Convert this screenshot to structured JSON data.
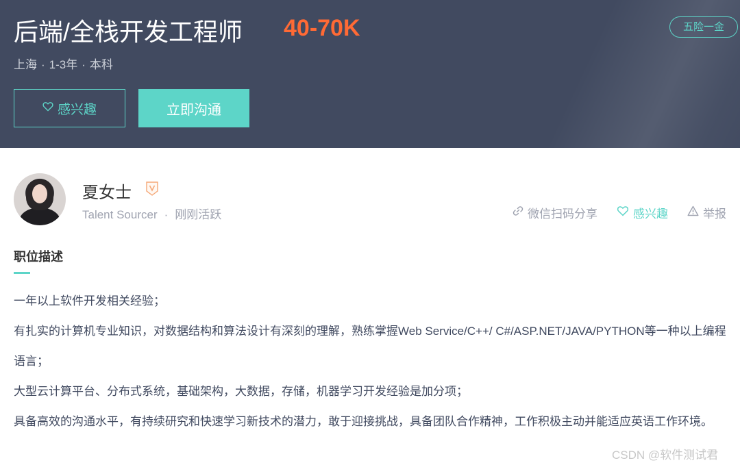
{
  "header": {
    "title": "后端/全栈开发工程师",
    "salary": "40-70K",
    "welfare_tag": "五险一金",
    "meta": {
      "city": "上海",
      "experience": "1-3年",
      "education": "本科",
      "separator": "·"
    },
    "buttons": {
      "interest": "感兴趣",
      "chat": "立即沟通"
    }
  },
  "recruiter": {
    "name": "夏女士",
    "title": "Talent Sourcer",
    "separator": "·",
    "status": "刚刚活跃"
  },
  "actions": {
    "share": "微信扫码分享",
    "interest": "感兴趣",
    "report": "举报"
  },
  "description": {
    "heading": "职位描述",
    "lines": [
      "一年以上软件开发相关经验；",
      "有扎实的计算机专业知识，对数据结构和算法设计有深刻的理解，熟练掌握Web Service/C++/ C#/ASP.NET/JAVA/PYTHON等一种以上编程语言；",
      "大型云计算平台、分布式系统，基础架构，大数据，存储，机器学习开发经验是加分项；",
      "具备高效的沟通水平，有持续研究和快速学习新技术的潜力，敢于迎接挑战，具备团队合作精神，工作积极主动并能适应英语工作环境。"
    ]
  },
  "watermark": "CSDN @软件测试君",
  "colors": {
    "banner": "#414a60",
    "accent": "#5dd5c8",
    "salary": "#ff6a35"
  },
  "icons": {
    "interest_button": "heart-icon",
    "verify": "verified-badge-icon",
    "share": "link-icon",
    "interest": "heart-icon",
    "report": "warning-icon"
  }
}
